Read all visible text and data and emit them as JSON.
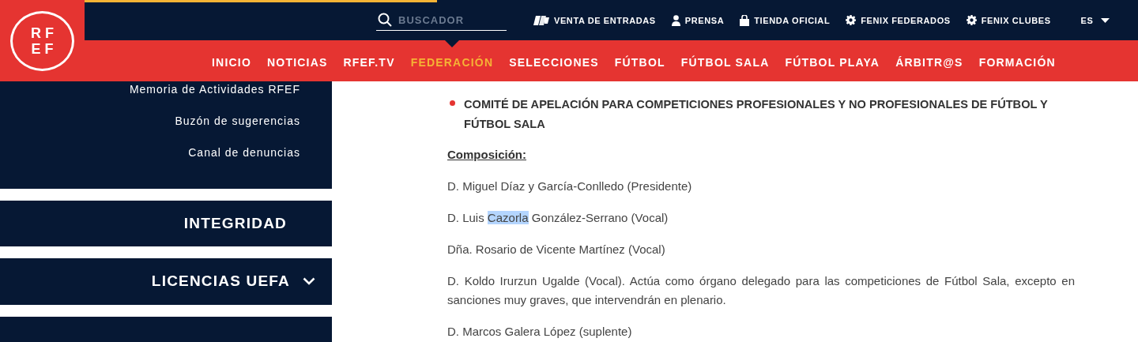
{
  "logo": {
    "lines": [
      "RF",
      "EF"
    ]
  },
  "search": {
    "placeholder": "BUSCADOR"
  },
  "top_links": [
    {
      "label": "VENTA DE ENTRADAS",
      "kind": "tickets"
    },
    {
      "label": "PRENSA",
      "kind": "press"
    },
    {
      "label": "TIENDA OFICIAL",
      "kind": "shop"
    },
    {
      "label": "FENIX FEDERADOS",
      "kind": "fenix"
    },
    {
      "label": "FENIX CLUBES",
      "kind": "fenix"
    }
  ],
  "language": {
    "label": "ES"
  },
  "nav": [
    {
      "label": "INICIO",
      "selected": false
    },
    {
      "label": "NOTICIAS",
      "selected": false
    },
    {
      "label": "RFEF.TV",
      "selected": false
    },
    {
      "label": "FEDERACIÓN",
      "selected": true
    },
    {
      "label": "SELECCIONES",
      "selected": false
    },
    {
      "label": "FÚTBOL",
      "selected": false
    },
    {
      "label": "FÚTBOL SALA",
      "selected": false
    },
    {
      "label": "FÚTBOL PLAYA",
      "selected": false
    },
    {
      "label": "ÁRBITR@S",
      "selected": false
    },
    {
      "label": "FORMACIÓN",
      "selected": false
    }
  ],
  "sidebar": {
    "links": [
      "Memoria de Actividades RFEF",
      "Buzón de sugerencias",
      "Canal de denuncias"
    ],
    "sections": [
      {
        "label": "INTEGRIDAD",
        "expandable": false
      },
      {
        "label": "LICENCIAS UEFA",
        "expandable": true
      }
    ]
  },
  "content": {
    "heading": "COMITÉ DE APELACIÓN PARA COMPETICIONES PROFESIONALES Y NO PROFESIONALES DE FÚTBOL Y FÚTBOL SALA",
    "subheading": "Composición:",
    "paragraphs": [
      {
        "segments": [
          {
            "text": "D. Miguel Díaz y García-Conlledo (Presidente)",
            "selected": false
          }
        ]
      },
      {
        "segments": [
          {
            "text": "D. Luis ",
            "selected": false
          },
          {
            "text": "Cazorla",
            "selected": true
          },
          {
            "text": " González-Serrano (Vocal)",
            "selected": false
          }
        ]
      },
      {
        "segments": [
          {
            "text": "Dña. Rosario de Vicente Martínez (Vocal)",
            "selected": false
          }
        ]
      },
      {
        "segments": [
          {
            "text": "D. Koldo Irurzun Ugalde (Vocal). Actúa como órgano delegado para las competiciones de Fútbol Sala, excepto en sanciones muy graves, que intervendrán en plenario.",
            "selected": false
          }
        ]
      },
      {
        "segments": [
          {
            "text": "D. Marcos Galera López (suplente)",
            "selected": false
          }
        ]
      }
    ]
  }
}
